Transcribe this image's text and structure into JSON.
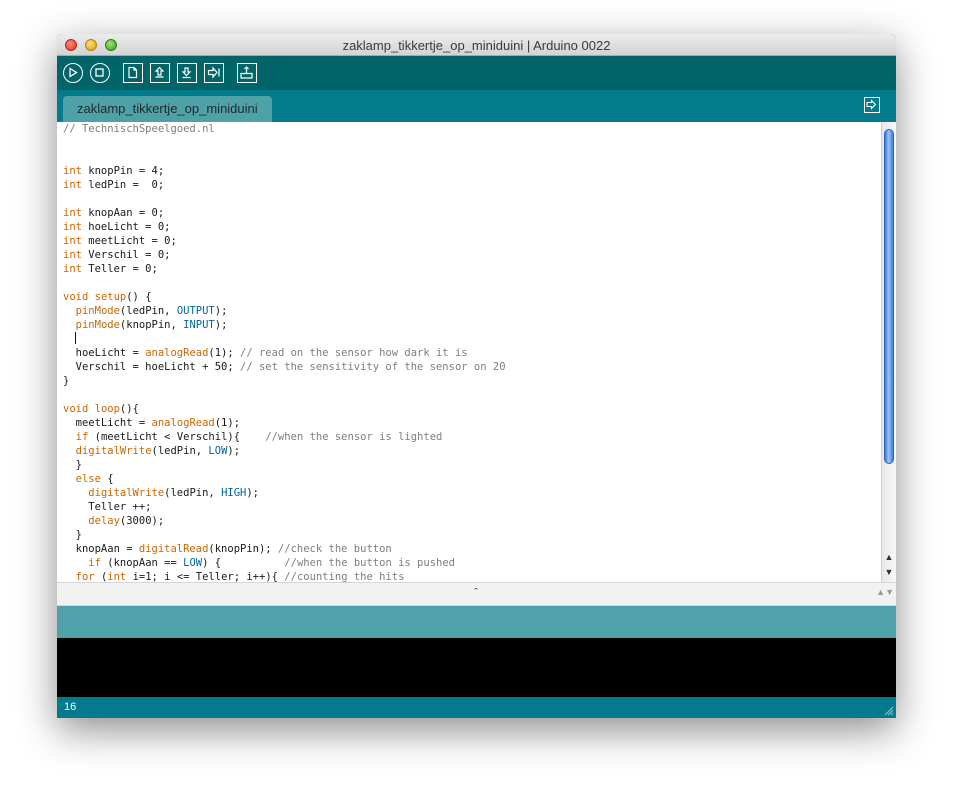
{
  "window": {
    "title": "zaklamp_tikkertje_op_miniduini | Arduino 0022"
  },
  "toolbar": {
    "buttons": [
      {
        "name": "verify",
        "icon": "play-icon"
      },
      {
        "name": "stop",
        "icon": "stop-icon"
      },
      {
        "name": "new",
        "icon": "new-file-icon"
      },
      {
        "name": "open",
        "icon": "open-upload-icon"
      },
      {
        "name": "save",
        "icon": "save-download-icon"
      },
      {
        "name": "upload",
        "icon": "upload-arrow-icon"
      },
      {
        "name": "serial-monitor",
        "icon": "serial-monitor-icon"
      }
    ]
  },
  "tabs": [
    {
      "label": "zaklamp_tikkertje_op_miniduini"
    }
  ],
  "tab_menu_icon": "tab-menu-arrow-icon",
  "colors": {
    "toolbar": "#006468",
    "tabbar": "#047b8c",
    "tab_active": "#4fa1a8",
    "status": "#4fa2aa",
    "keyword": "#cc6600",
    "constant": "#006699",
    "comment": "#7e7e7e"
  },
  "code_lines": [
    "// TechnischSpeelgoed.nl",
    "",
    "",
    "int knopPin = 4;",
    "int ledPin =  0;",
    "",
    "int knopAan = 0;",
    "int hoeLicht = 0;",
    "int meetLicht = 0;",
    "int Verschil = 0;",
    "int Teller = 0;",
    "",
    "void setup() {",
    "  pinMode(ledPin, OUTPUT);",
    "  pinMode(knopPin, INPUT);",
    "",
    "  hoeLicht = analogRead(1); // read on the sensor how dark it is",
    "  Verschil = hoeLicht + 50; // set the sensitivity of the sensor on 20",
    "}",
    "",
    "void loop(){",
    "  meetLicht = analogRead(1);",
    "  if (meetLicht < Verschil){    //when the sensor is lighted",
    "  digitalWrite(ledPin, LOW);",
    "  }",
    "  else {",
    "    digitalWrite(ledPin, HIGH);",
    "    Teller ++;",
    "    delay(3000);",
    "  }",
    "  knopAan = digitalRead(knopPin); //check the button",
    "    if (knopAan == LOW) {          //when the button is pushed",
    "  for (int i=1; i <= Teller; i++){ //counting the hits"
  ],
  "editor": {
    "caret_line": 16,
    "scroll_up_glyph": "▲",
    "scroll_down_glyph": "▼"
  },
  "divider": {
    "handle_glyph": "ˆ",
    "grip_glyph": "▲▼"
  },
  "status": {
    "message": "",
    "console_text": "",
    "line_number": "16"
  }
}
